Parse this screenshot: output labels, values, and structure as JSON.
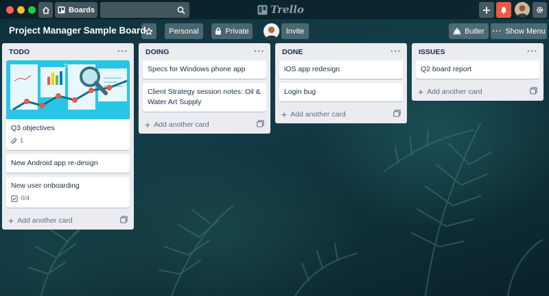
{
  "topbar": {
    "boards_label": "Boards",
    "logo_text": "Trello",
    "icons": [
      "home-icon",
      "boards-icon",
      "search-icon",
      "plus-icon",
      "bell-icon",
      "gear-icon"
    ]
  },
  "board": {
    "title": "Project Manager Sample Board",
    "personal_label": "Personal",
    "private_label": "Private",
    "invite_label": "Invite",
    "butler_label": "Butler",
    "show_menu_label": "Show Menu",
    "notification_color": "#eb5a46"
  },
  "lists": [
    {
      "title": "TODO",
      "cards": [
        {
          "title": "Q3 objectives",
          "has_cover": true,
          "attachments": "1"
        },
        {
          "title": "New Android app re-design"
        },
        {
          "title": "New user onboarding",
          "checklist": "0/4"
        }
      ],
      "add_label": "Add another card"
    },
    {
      "title": "DOING",
      "cards": [
        {
          "title": "Specs for Windows phone app"
        },
        {
          "title": "Client Strategy session notes: Oil & Water Art Supply"
        }
      ],
      "add_label": "Add another card"
    },
    {
      "title": "DONE",
      "cards": [
        {
          "title": "iOS app redesign"
        },
        {
          "title": "Login bug"
        }
      ],
      "add_label": "Add another card"
    },
    {
      "title": "ISSUES",
      "cards": [
        {
          "title": "Q2 board report"
        }
      ],
      "add_label": "Add another card"
    }
  ]
}
